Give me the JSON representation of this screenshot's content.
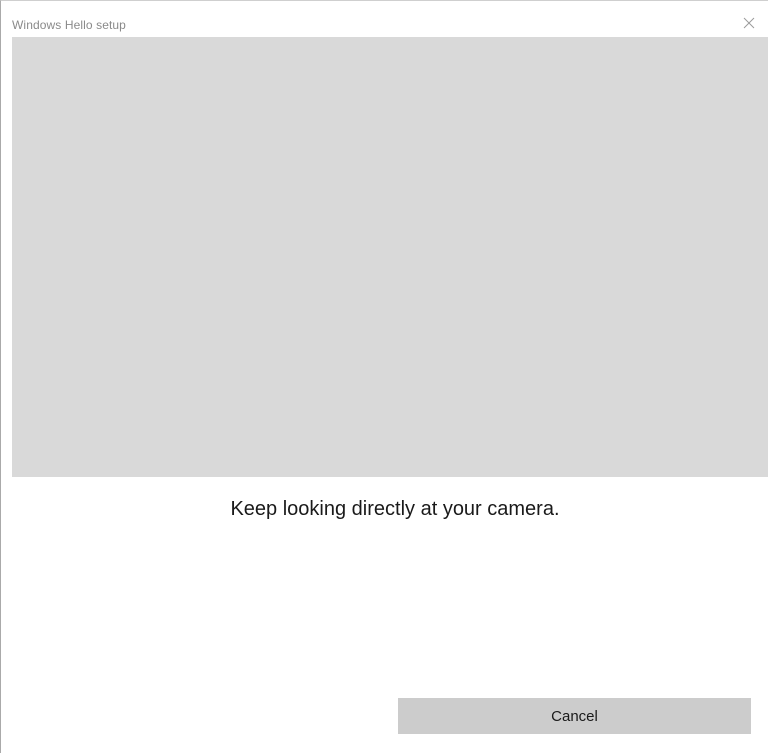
{
  "window": {
    "title": "Windows Hello setup"
  },
  "icons": {
    "close": "close-icon"
  },
  "main": {
    "instruction": "Keep looking directly at your camera.",
    "cancel_label": "Cancel"
  },
  "colors": {
    "preview_background": "#d9d9d9",
    "button_background": "#cccccc"
  }
}
